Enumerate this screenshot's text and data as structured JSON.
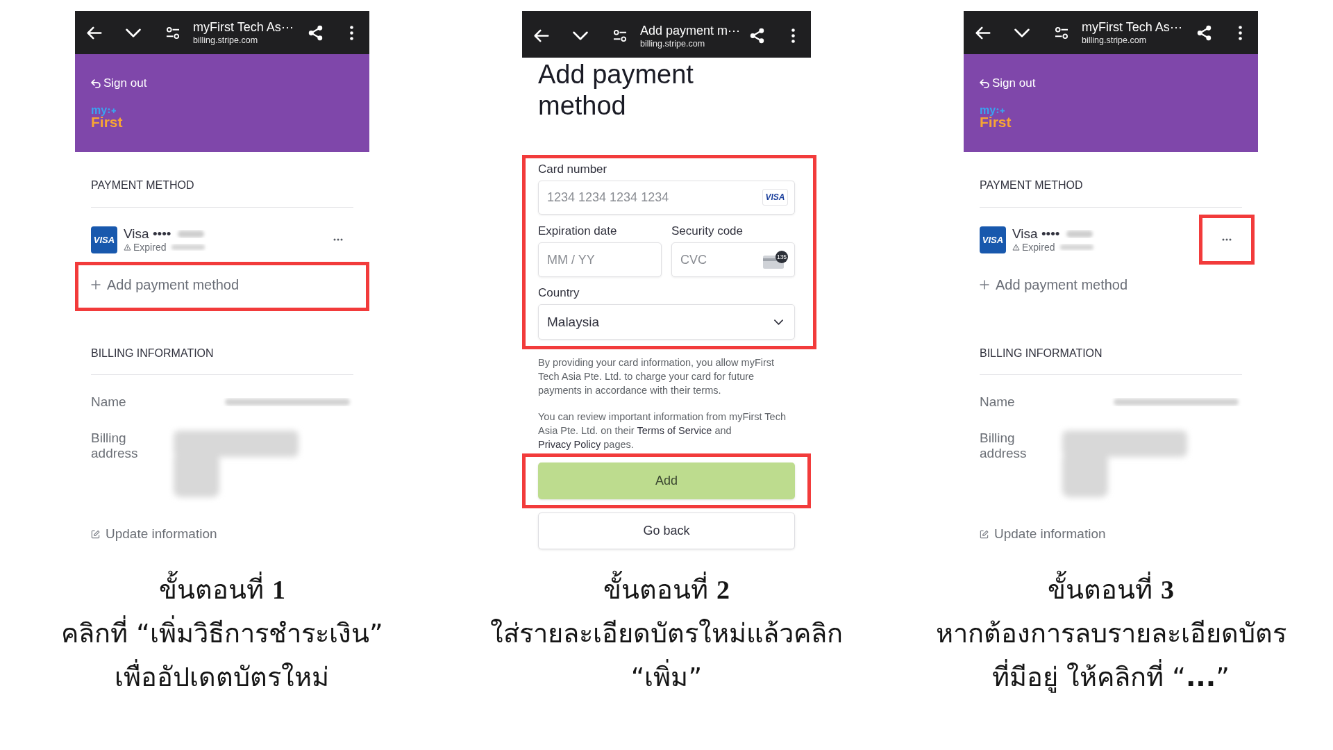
{
  "steps": [
    {
      "screen": {
        "kind": "billing",
        "browser": {
          "title": "myFirst Tech As⋯",
          "url": "billing.stripe.com"
        },
        "header": {
          "sign_out": "Sign out",
          "logo_top": "my",
          "logo_bottom": "First"
        },
        "payment_section": {
          "heading": "PAYMENT METHOD",
          "card": {
            "badge": "VISA",
            "label": "Visa ••••",
            "number_redacted": true,
            "status": "Expired",
            "date_redacted": true,
            "menu_highlighted": false
          },
          "add_link": {
            "label": "Add payment method",
            "highlighted": true
          }
        },
        "billing_section": {
          "heading": "BILLING INFORMATION",
          "rows": [
            {
              "kind": "single_line",
              "label": "Name",
              "redacted": true
            },
            {
              "kind": "multi_line",
              "label": "Billing address",
              "redacted": true
            }
          ],
          "update_link": "Update information"
        }
      },
      "title": "ขั้นตอนที่ **1**",
      "description": [
        "คลิกที่ “เพิ่มวิธีการชำระเงิน”",
        "เพื่ออัปเดตบัตรใหม่"
      ]
    },
    {
      "screen": {
        "kind": "add_form",
        "browser": {
          "title": "Add payment m⋯",
          "url": "billing.stripe.com"
        },
        "heading": "Add payment method",
        "form": {
          "highlighted": true,
          "card_number": {
            "label": "Card number",
            "placeholder": "1234 1234 1234 1234",
            "badge": "VISA"
          },
          "expiry": {
            "label": "Expiration date",
            "placeholder": "MM / YY"
          },
          "security_code": {
            "label": "Security code",
            "placeholder": "CVC",
            "hint": "135"
          },
          "country": {
            "label": "Country",
            "value": "Malaysia"
          }
        },
        "consent": [
          {
            "parts": [
              {
                "kind": "text",
                "text": "By providing your card information, you allow myFirst Tech Asia Pte. Ltd. to charge your card for future payments in accordance with their terms."
              }
            ]
          },
          {
            "parts": [
              {
                "kind": "text",
                "text": "You can review important information from myFirst Tech Asia Pte. Ltd. on their "
              },
              {
                "kind": "link",
                "text": "Terms of Service"
              },
              {
                "kind": "text",
                "text": " and "
              },
              {
                "kind": "link",
                "text": "Privacy Policy"
              },
              {
                "kind": "text",
                "text": " pages."
              }
            ]
          }
        ],
        "submit": {
          "label": "Add",
          "highlighted": true
        },
        "back_button": "Go back"
      },
      "title": "ขั้นตอนที่ **2**",
      "description": [
        "ใส่รายละเอียดบัตรใหม่แล้วคลิก",
        "“เพิ่ม”"
      ]
    },
    {
      "screen": {
        "kind": "billing",
        "browser": {
          "title": "myFirst Tech As⋯",
          "url": "billing.stripe.com"
        },
        "header": {
          "sign_out": "Sign out",
          "logo_top": "my",
          "logo_bottom": "First"
        },
        "payment_section": {
          "heading": "PAYMENT METHOD",
          "card": {
            "badge": "VISA",
            "label": "Visa ••••",
            "number_redacted": true,
            "status": "Expired",
            "date_redacted": true,
            "menu_highlighted": true
          },
          "add_link": {
            "label": "Add payment method",
            "highlighted": false
          }
        },
        "billing_section": {
          "heading": "BILLING INFORMATION",
          "rows": [
            {
              "kind": "single_line",
              "label": "Name",
              "redacted": true
            },
            {
              "kind": "multi_line",
              "label": "Billing address",
              "redacted": true
            }
          ],
          "update_link": "Update information"
        }
      },
      "title": "ขั้นตอนที่ **3**",
      "description": [
        "หากต้องการลบรายละเอียดบัตร",
        "ที่มีอยู่ ให้คลิกที่ “**...**”"
      ]
    }
  ]
}
